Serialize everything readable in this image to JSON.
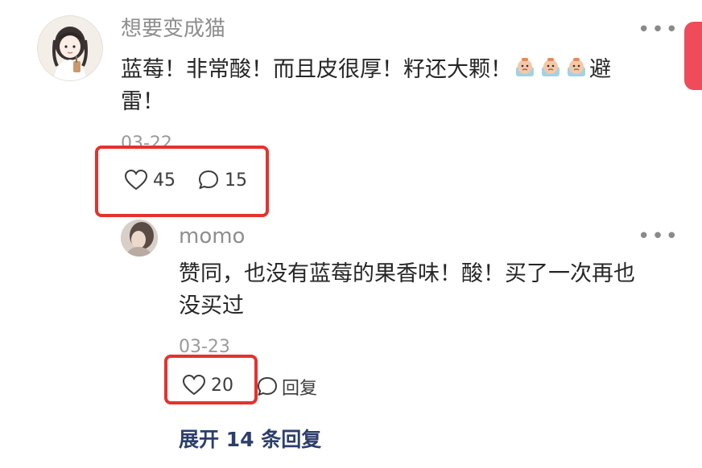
{
  "comment": {
    "username": "想要变成猫",
    "text_line1": "蓝莓！非常酸！而且皮很厚！籽还大颗！",
    "emoji_name": "crying-face-emoji",
    "text_line1_tail": "避",
    "text_line2": "雷！",
    "date": "03-22",
    "likes": "45",
    "replies": "15"
  },
  "reply": {
    "username": "momo",
    "text_line1": "赞同，也没有蓝莓的果香味！酸！买了一次再也",
    "text_line2": "没买过",
    "date": "03-23",
    "likes": "20",
    "reply_label": "回复"
  },
  "expand_label": "展开 14 条回复",
  "colors": {
    "highlight": "#e5322d",
    "link": "#2c3e6b",
    "side_tab": "#ef4b5a"
  }
}
